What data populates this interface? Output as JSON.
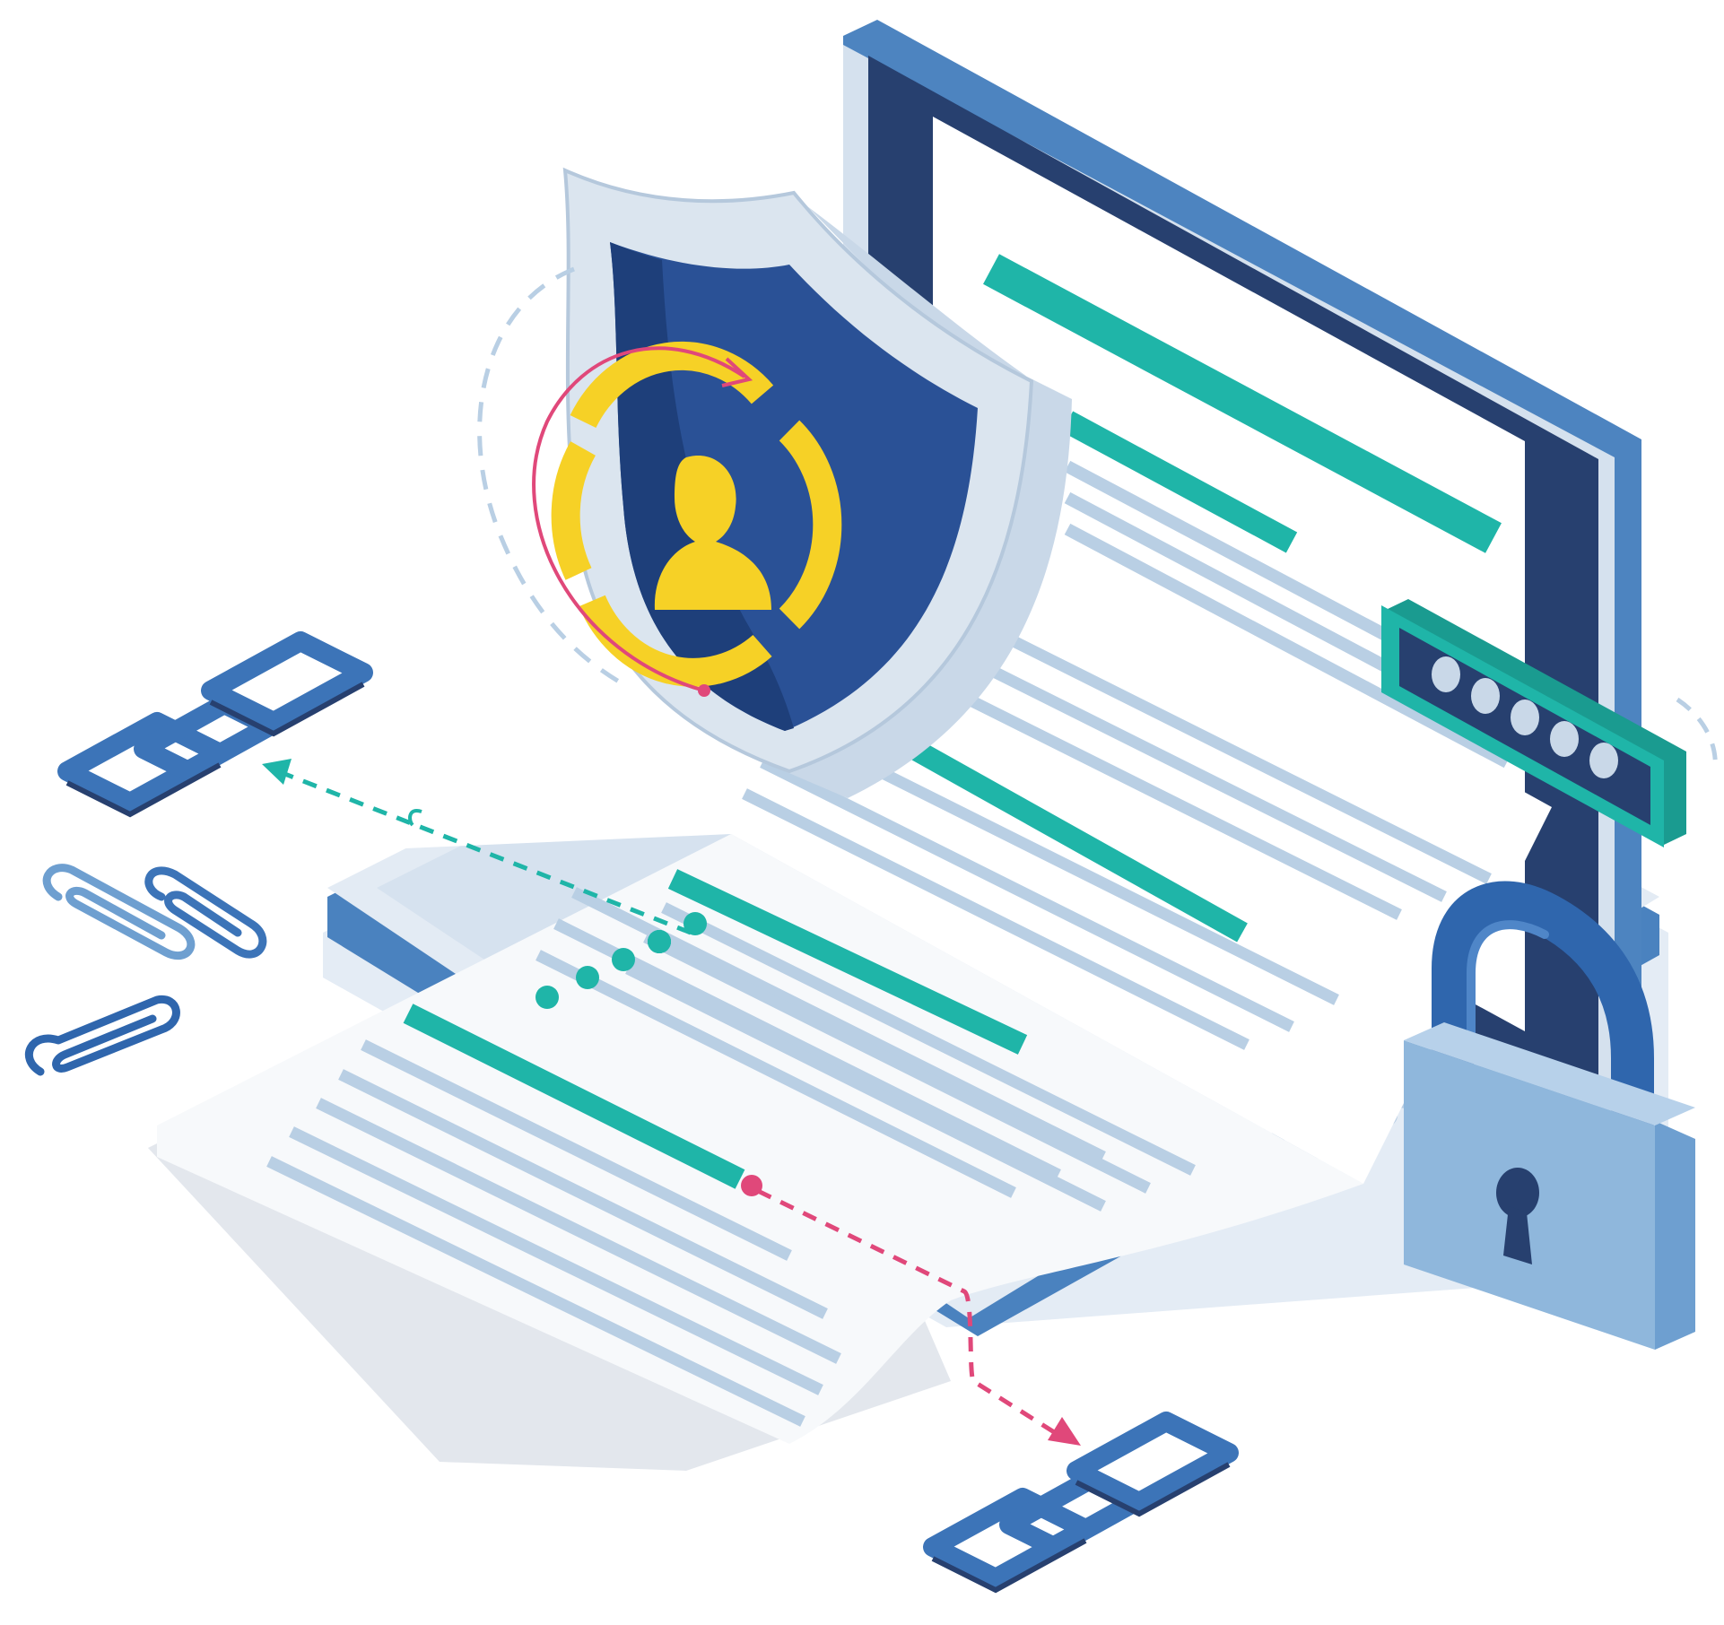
{
  "illustration": {
    "subject": "document-security",
    "palette": {
      "background": "#ffffff",
      "navy": "#27406f",
      "shield_blue": "#2a5196",
      "screen_blue": "#2c4f9a",
      "frame_light": "#d5e1ee",
      "frame_edge": "#4d84c0",
      "teal": "#1fb5a8",
      "line_blue": "#b9cfe4",
      "yellow": "#f6d126",
      "pink": "#e0487a",
      "lock_body": "#8fb7dc",
      "lock_shackle": "#2f66ad",
      "chain": "#3c74b8",
      "paper": "#f5f7fa"
    },
    "icons": [
      "laptop-icon",
      "shield-icon",
      "user-icon",
      "password-field-icon",
      "padlock-icon",
      "keyhole-icon",
      "chain-link-icon",
      "paperclip-icon",
      "document-icon",
      "arrow-icon"
    ],
    "password_mask_dots": 5
  }
}
